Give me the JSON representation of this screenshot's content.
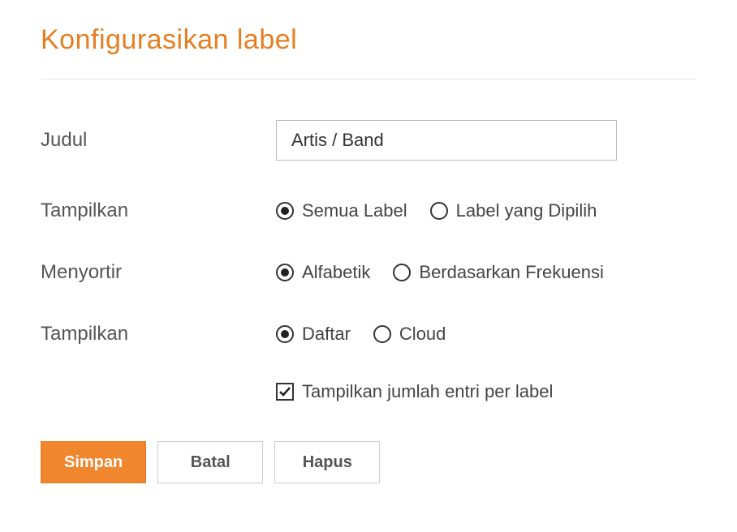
{
  "title": "Konfigurasikan label",
  "form": {
    "judul": {
      "label": "Judul",
      "value": "Artis / Band"
    },
    "tampilkan1": {
      "label": "Tampilkan",
      "options": {
        "semua": "Semua Label",
        "dipilih": "Label yang Dipilih"
      }
    },
    "menyortir": {
      "label": "Menyortir",
      "options": {
        "alfabetik": "Alfabetik",
        "frekuensi": "Berdasarkan Frekuensi"
      }
    },
    "tampilkan2": {
      "label": "Tampilkan",
      "options": {
        "daftar": "Daftar",
        "cloud": "Cloud"
      }
    },
    "checkbox": {
      "label": "Tampilkan jumlah entri per label"
    }
  },
  "buttons": {
    "save": "Simpan",
    "cancel": "Batal",
    "delete": "Hapus"
  }
}
